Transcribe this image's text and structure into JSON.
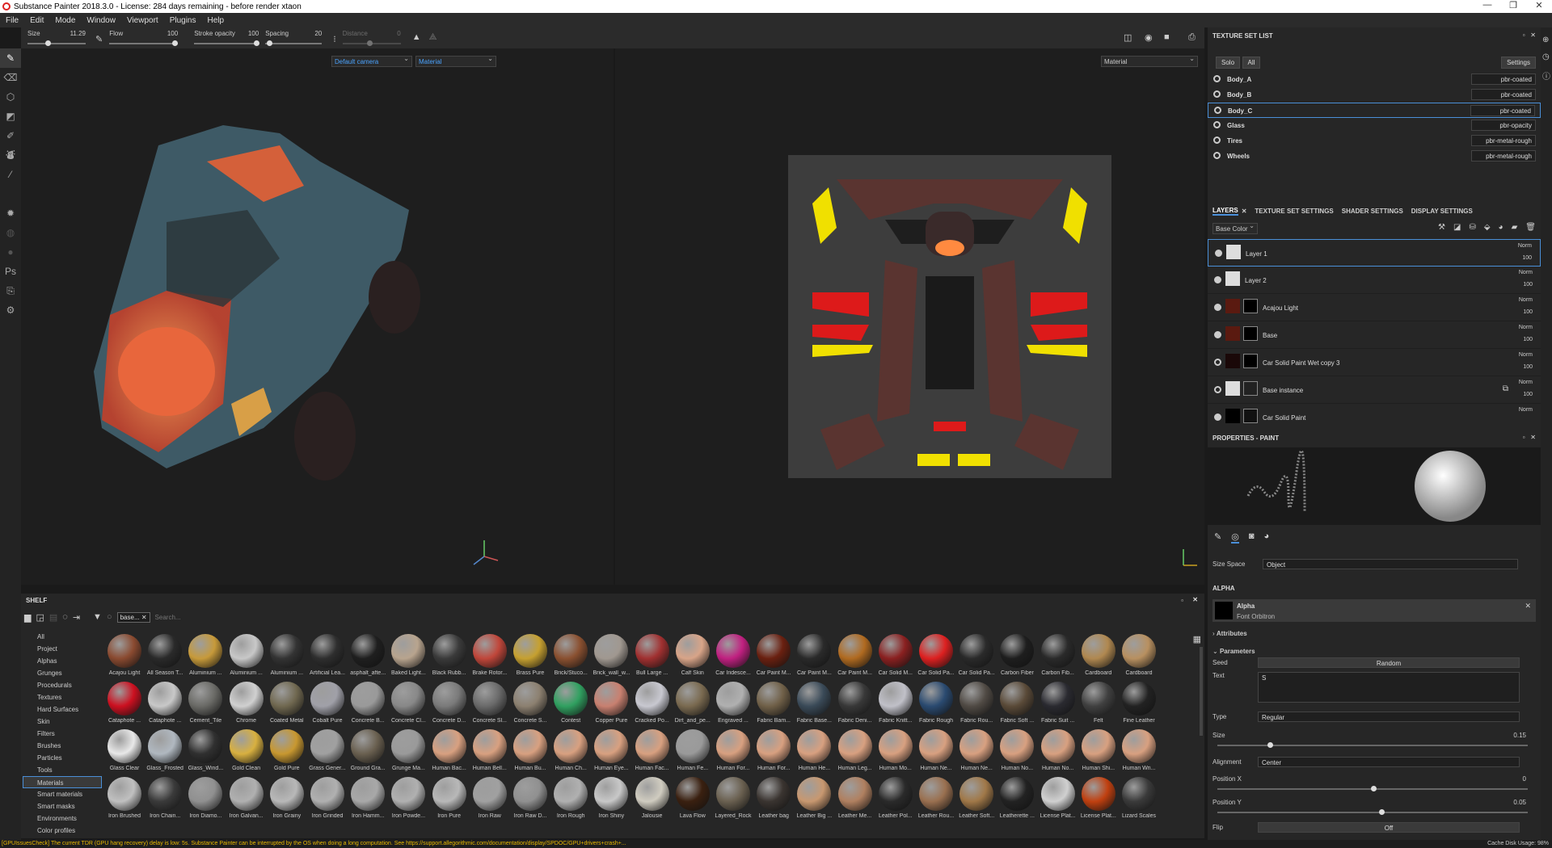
{
  "window": {
    "title": "Substance Painter 2018.3.0 - License: 284 days remaining - before render xtaon"
  },
  "menu": [
    "File",
    "Edit",
    "Mode",
    "Window",
    "Viewport",
    "Plugins",
    "Help"
  ],
  "toolbar": {
    "size_label": "Size",
    "size_value": "11.29",
    "flow_label": "Flow",
    "flow_value": "100",
    "stroke_label": "Stroke opacity",
    "stroke_value": "100",
    "spacing_label": "Spacing",
    "spacing_value": "20",
    "distance_label": "Distance",
    "distance_value": "0"
  },
  "viewport": {
    "camera": "Default camera",
    "mode3d": "Material",
    "mode2d": "Material"
  },
  "shelf": {
    "title": "SHELF",
    "filter_chip": "base...",
    "search_placeholder": "Search...",
    "categories": [
      "All",
      "Project",
      "Alphas",
      "Grunges",
      "Procedurals",
      "Textures",
      "Hard Surfaces",
      "Skin",
      "Filters",
      "Brushes",
      "Particles",
      "Tools",
      "Materials",
      "Smart materials",
      "Smart masks",
      "Environments",
      "Color profiles"
    ],
    "selected_category": "Materials",
    "materials": [
      {
        "n": "Acajou Light",
        "c": "#8a4a30"
      },
      {
        "n": "All Season T...",
        "c": "#2a2a2a"
      },
      {
        "n": "Aluminium ...",
        "c": "#c79a3a"
      },
      {
        "n": "Aluminium ...",
        "c": "#c8c8c8"
      },
      {
        "n": "Aluminium ...",
        "c": "#333333"
      },
      {
        "n": "Artificial Lea...",
        "c": "#2e2e2e"
      },
      {
        "n": "asphalt_afte...",
        "c": "#1f1f1f"
      },
      {
        "n": "Baked Light...",
        "c": "#b8a48e"
      },
      {
        "n": "Black Rubb...",
        "c": "#3a3a3a"
      },
      {
        "n": "Brake Rotor...",
        "c": "#c0463a"
      },
      {
        "n": "Brass Pure",
        "c": "#c6a030"
      },
      {
        "n": "Brick/Stuco...",
        "c": "#8a5030"
      },
      {
        "n": "Brick_wall_w...",
        "c": "#a09890"
      },
      {
        "n": "Bull Large ...",
        "c": "#a03030"
      },
      {
        "n": "Calf Skin",
        "c": "#d8a488"
      },
      {
        "n": "Car Iridesce...",
        "c": "#c02080"
      },
      {
        "n": "Car Paint M...",
        "c": "#6a2010"
      },
      {
        "n": "Car Paint M...",
        "c": "#2a2a2a"
      },
      {
        "n": "Car Paint M...",
        "c": "#b06a20"
      },
      {
        "n": "Car Solid M...",
        "c": "#8a2020"
      },
      {
        "n": "Car Solid Pa...",
        "c": "#dd2020"
      },
      {
        "n": "Car Solid Pa...",
        "c": "#2a2a2a"
      },
      {
        "n": "Carbon Fiber",
        "c": "#1e1e1e"
      },
      {
        "n": "Carbon Fib...",
        "c": "#2a2a2a"
      },
      {
        "n": "Cardboard",
        "c": "#b08850"
      },
      {
        "n": "Cardboard",
        "c": "#b89060"
      },
      {
        "n": "Cataphote ...",
        "c": "#cc1020"
      },
      {
        "n": "Cataphote ...",
        "c": "#c8c8c8"
      },
      {
        "n": "Cement_Tile",
        "c": "#6a6a66"
      },
      {
        "n": "Chrome",
        "c": "#d0d0d0"
      },
      {
        "n": "Coated Metal",
        "c": "#706850"
      },
      {
        "n": "Cobalt Pure",
        "c": "#a0a0a8"
      },
      {
        "n": "Concrete B...",
        "c": "#9a9a9a"
      },
      {
        "n": "Concrete Cl...",
        "c": "#888888"
      },
      {
        "n": "Concrete D...",
        "c": "#7a7a7a"
      },
      {
        "n": "Concrete Sl...",
        "c": "#6a6a6a"
      },
      {
        "n": "Concrete S...",
        "c": "#8c8070"
      },
      {
        "n": "Contest",
        "c": "#30a060"
      },
      {
        "n": "Copper Pure",
        "c": "#c88070"
      },
      {
        "n": "Cracked Po...",
        "c": "#c8c8d0"
      },
      {
        "n": "Dirt_and_pe...",
        "c": "#7a6a50"
      },
      {
        "n": "Engraved ...",
        "c": "#b0b0b0"
      },
      {
        "n": "Fabric Bam...",
        "c": "#706048"
      },
      {
        "n": "Fabric Base...",
        "c": "#3a4a58"
      },
      {
        "n": "Fabric Deni...",
        "c": "#383838"
      },
      {
        "n": "Fabric Knitt...",
        "c": "#c0c0c8"
      },
      {
        "n": "Fabric Rough",
        "c": "#2a4a70"
      },
      {
        "n": "Fabric Rou...",
        "c": "#504a44"
      },
      {
        "n": "Fabric Soft ...",
        "c": "#5a4a38"
      },
      {
        "n": "Fabric Suit ...",
        "c": "#2a2a30"
      },
      {
        "n": "Felt",
        "c": "#404040"
      },
      {
        "n": "Fine Leather",
        "c": "#222222"
      },
      {
        "n": "Glass Clear",
        "c": "#e8e8e8"
      },
      {
        "n": "Glass_Frosted",
        "c": "#b0b8c0"
      },
      {
        "n": "Glass_Wind...",
        "c": "#303030"
      },
      {
        "n": "Gold Clean",
        "c": "#d8b040"
      },
      {
        "n": "Gold Pure",
        "c": "#c89830"
      },
      {
        "n": "Grass Gener...",
        "c": "#a0a0a0"
      },
      {
        "n": "Ground Gra...",
        "c": "#6a6050"
      },
      {
        "n": "Grunge Ma...",
        "c": "#9a9a9a"
      },
      {
        "n": "Human Bac...",
        "c": "#d8a080"
      },
      {
        "n": "Human Bell...",
        "c": "#d8a080"
      },
      {
        "n": "Human Bu...",
        "c": "#d8a080"
      },
      {
        "n": "Human Ch...",
        "c": "#d8a080"
      },
      {
        "n": "Human Eye...",
        "c": "#d8a080"
      },
      {
        "n": "Human Fac...",
        "c": "#d8a080"
      },
      {
        "n": "Human Fe...",
        "c": "#9a9a9a"
      },
      {
        "n": "Human For...",
        "c": "#d8a080"
      },
      {
        "n": "Human For...",
        "c": "#d8a080"
      },
      {
        "n": "Human He...",
        "c": "#d8a080"
      },
      {
        "n": "Human Leg...",
        "c": "#d8a080"
      },
      {
        "n": "Human Mo...",
        "c": "#d8a080"
      },
      {
        "n": "Human Ne...",
        "c": "#d8a080"
      },
      {
        "n": "Human Ne...",
        "c": "#d8a080"
      },
      {
        "n": "Human No...",
        "c": "#d8a080"
      },
      {
        "n": "Human No...",
        "c": "#d8a080"
      },
      {
        "n": "Human Shi...",
        "c": "#d8a080"
      },
      {
        "n": "Human Wri...",
        "c": "#d8a080"
      },
      {
        "n": "Iron Brushed",
        "c": "#c0c0c0"
      },
      {
        "n": "Iron Chain...",
        "c": "#3a3a3a"
      },
      {
        "n": "Iron Diamo...",
        "c": "#909090"
      },
      {
        "n": "Iron Galvan...",
        "c": "#b0b0b0"
      },
      {
        "n": "Iron Grainy",
        "c": "#b8b8b8"
      },
      {
        "n": "Iron Grinded",
        "c": "#b0b0b0"
      },
      {
        "n": "Iron Hamm...",
        "c": "#a8a8a8"
      },
      {
        "n": "Iron Powde...",
        "c": "#b0b0b0"
      },
      {
        "n": "Iron Pure",
        "c": "#b8b8b8"
      },
      {
        "n": "Iron Raw",
        "c": "#a0a0a0"
      },
      {
        "n": "Iron Raw D...",
        "c": "#909090"
      },
      {
        "n": "Iron Rough",
        "c": "#b0b0b0"
      },
      {
        "n": "Iron Shiny",
        "c": "#c8c8c8"
      },
      {
        "n": "Jalousie",
        "c": "#d0ccc0"
      },
      {
        "n": "Lava Flow",
        "c": "#3a2010"
      },
      {
        "n": "Layered_Rock",
        "c": "#6a6050"
      },
      {
        "n": "Leather bag",
        "c": "#3a3430"
      },
      {
        "n": "Leather Big ...",
        "c": "#c89870"
      },
      {
        "n": "Leather Me...",
        "c": "#b08060"
      },
      {
        "n": "Leather Pol...",
        "c": "#2a2a2a"
      },
      {
        "n": "Leather Rou...",
        "c": "#9a7050"
      },
      {
        "n": "Leather Soft...",
        "c": "#a07848"
      },
      {
        "n": "Leatherette ...",
        "c": "#222222"
      },
      {
        "n": "License Plat...",
        "c": "#d0d0d0"
      },
      {
        "n": "License Plat...",
        "c": "#c04010"
      },
      {
        "n": "Lizard Scales",
        "c": "#3a3a3a"
      }
    ]
  },
  "texture_set_list": {
    "title": "TEXTURE SET LIST",
    "solo": "Solo",
    "all": "All",
    "settings": "Settings",
    "rows": [
      {
        "name": "Body_A",
        "shader": "pbr-coated"
      },
      {
        "name": "Body_B",
        "shader": "pbr-coated"
      },
      {
        "name": "Body_C",
        "shader": "pbr-coated"
      },
      {
        "name": "Glass",
        "shader": "pbr-opacity"
      },
      {
        "name": "Tires",
        "shader": "pbr-metal-rough"
      },
      {
        "name": "Wheels",
        "shader": "pbr-metal-rough"
      }
    ]
  },
  "layers_tabs": [
    "LAYERS",
    "TEXTURE SET SETTINGS",
    "SHADER SETTINGS",
    "DISPLAY SETTINGS"
  ],
  "layers": {
    "channel": "Base Color",
    "rows": [
      {
        "name": "Layer 1",
        "blend": "Norm",
        "opacity": "100"
      },
      {
        "name": "Layer 2",
        "blend": "Norm",
        "opacity": "100"
      },
      {
        "name": "Acajou Light",
        "blend": "Norm",
        "opacity": "100"
      },
      {
        "name": "Base",
        "blend": "Norm",
        "opacity": "100"
      },
      {
        "name": "Car Solid Paint Wet copy 3",
        "blend": "Norm",
        "opacity": "100"
      },
      {
        "name": "Base instance",
        "blend": "Norm",
        "opacity": "100"
      },
      {
        "name": "Car Solid Paint",
        "blend": "Norm",
        "opacity": ""
      }
    ]
  },
  "properties": {
    "title": "PROPERTIES - PAINT",
    "size_space_label": "Size Space",
    "size_space_value": "Object",
    "alpha_section": "ALPHA",
    "alpha_name": "Alpha",
    "alpha_sub": "Font Orbitron",
    "attributes": "Attributes",
    "parameters": "Parameters",
    "seed_label": "Seed",
    "seed_value": "Random",
    "text_label": "Text",
    "text_value": "S",
    "type_label": "Type",
    "type_value": "Regular",
    "size_label": "Size",
    "size_value": "0.15",
    "alignment_label": "Alignment",
    "alignment_value": "Center",
    "posx_label": "Position X",
    "posx_value": "0",
    "posy_label": "Position Y",
    "posy_value": "0.05",
    "flip_label": "Flip",
    "flip_value": "Off"
  },
  "status": {
    "message": "[GPUIssuesCheck] The current TDR (GPU hang recovery) delay is low: 5s. Substance Painter can be interrupted by the OS when doing a long computation. See https://support.allegorithmic.com/documentation/display/SPDOC/GPU+drivers+crash+...",
    "cache_label": "Cache Disk Usage:",
    "cache_value": "98%"
  }
}
